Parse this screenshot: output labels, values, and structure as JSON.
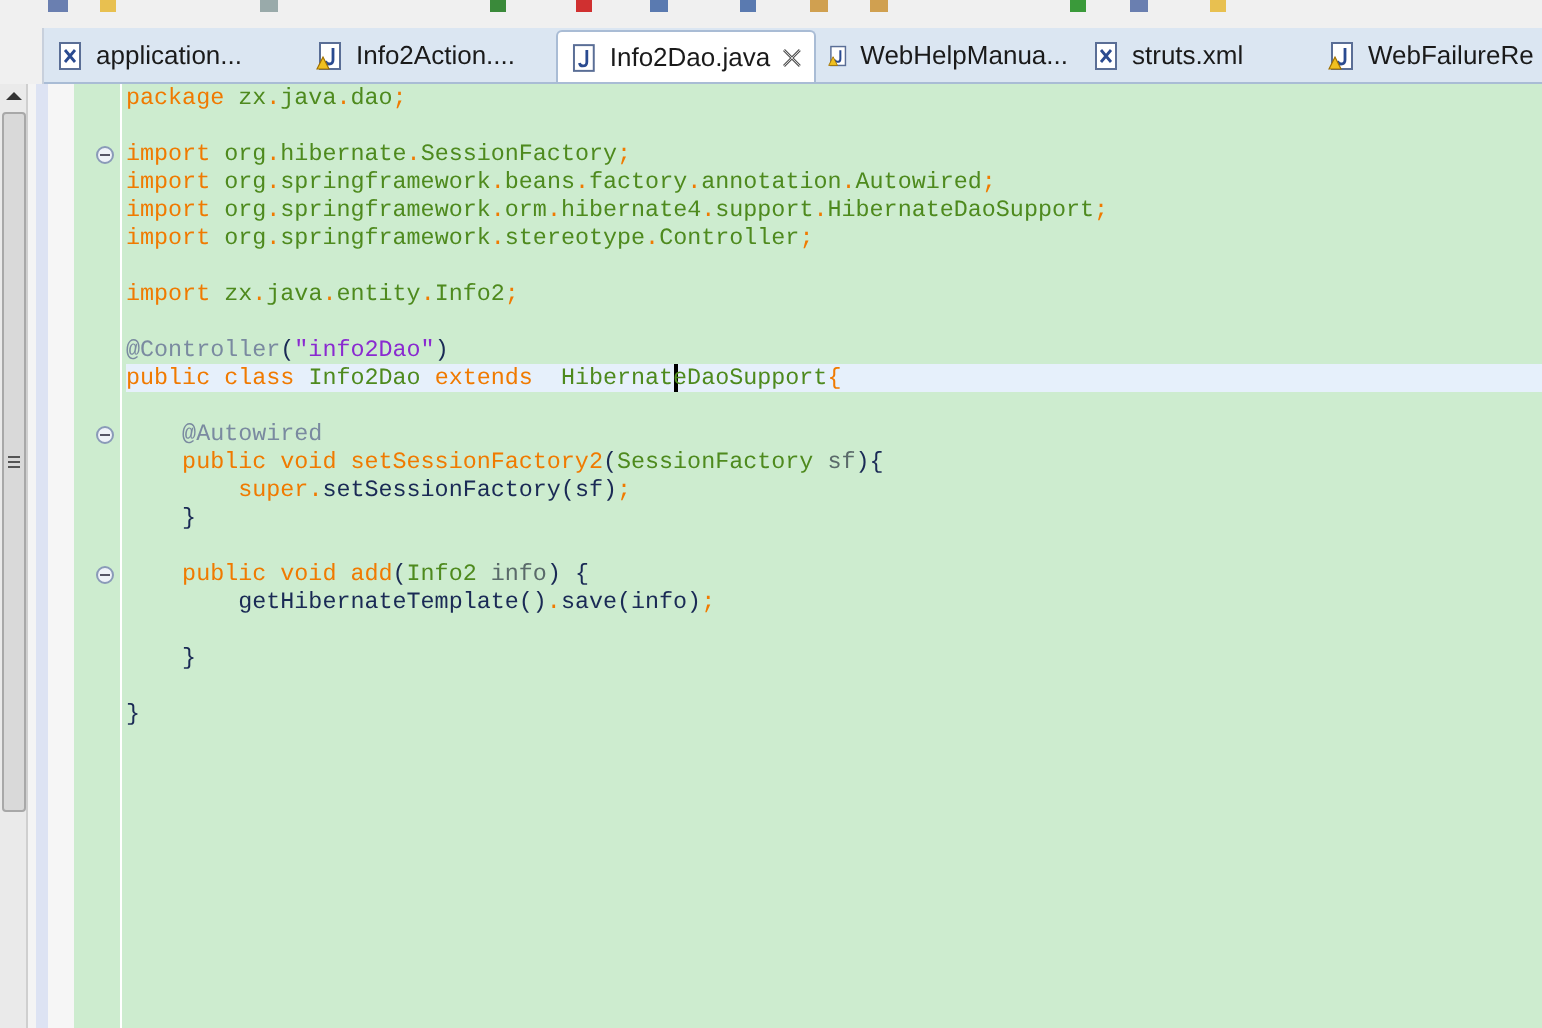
{
  "tabs": [
    {
      "label": "application...",
      "kind": "xml",
      "warning": false,
      "selected": false
    },
    {
      "label": "Info2Action....",
      "kind": "java",
      "warning": true,
      "selected": false
    },
    {
      "label": "Info2Dao.java",
      "kind": "java",
      "warning": false,
      "selected": true
    },
    {
      "label": "WebHelpManua...",
      "kind": "java",
      "warning": true,
      "selected": false
    },
    {
      "label": "struts.xml",
      "kind": "xml",
      "warning": false,
      "selected": false
    },
    {
      "label": "WebFailureRe",
      "kind": "java",
      "warning": true,
      "selected": false
    }
  ],
  "editor": {
    "lines": [
      {
        "fold": false,
        "current": false,
        "tokens": [
          {
            "kind": "keyword",
            "text": "package "
          },
          {
            "kind": "name",
            "text": "zx"
          },
          {
            "kind": "punct",
            "text": "."
          },
          {
            "kind": "name",
            "text": "java"
          },
          {
            "kind": "punct",
            "text": "."
          },
          {
            "kind": "name",
            "text": "dao"
          },
          {
            "kind": "punct",
            "text": ";"
          }
        ]
      },
      {
        "fold": false,
        "current": false
      },
      {
        "fold": true,
        "current": false,
        "tokens": [
          {
            "kind": "keyword",
            "text": "import "
          },
          {
            "kind": "name",
            "text": "org"
          },
          {
            "kind": "punct",
            "text": "."
          },
          {
            "kind": "name",
            "text": "hibernate"
          },
          {
            "kind": "punct",
            "text": "."
          },
          {
            "kind": "name",
            "text": "SessionFactory"
          },
          {
            "kind": "punct",
            "text": ";"
          }
        ]
      },
      {
        "fold": false,
        "current": false,
        "tokens": [
          {
            "kind": "keyword",
            "text": "import "
          },
          {
            "kind": "name",
            "text": "org"
          },
          {
            "kind": "punct",
            "text": "."
          },
          {
            "kind": "name",
            "text": "springframework"
          },
          {
            "kind": "punct",
            "text": "."
          },
          {
            "kind": "name",
            "text": "beans"
          },
          {
            "kind": "punct",
            "text": "."
          },
          {
            "kind": "name",
            "text": "factory"
          },
          {
            "kind": "punct",
            "text": "."
          },
          {
            "kind": "name",
            "text": "annotation"
          },
          {
            "kind": "punct",
            "text": "."
          },
          {
            "kind": "name",
            "text": "Autowired"
          },
          {
            "kind": "punct",
            "text": ";"
          }
        ]
      },
      {
        "fold": false,
        "current": false,
        "tokens": [
          {
            "kind": "keyword",
            "text": "import "
          },
          {
            "kind": "name",
            "text": "org"
          },
          {
            "kind": "punct",
            "text": "."
          },
          {
            "kind": "name",
            "text": "springframework"
          },
          {
            "kind": "punct",
            "text": "."
          },
          {
            "kind": "name",
            "text": "orm"
          },
          {
            "kind": "punct",
            "text": "."
          },
          {
            "kind": "name",
            "text": "hibernate4"
          },
          {
            "kind": "punct",
            "text": "."
          },
          {
            "kind": "name",
            "text": "support"
          },
          {
            "kind": "punct",
            "text": "."
          },
          {
            "kind": "name",
            "text": "HibernateDaoSupport"
          },
          {
            "kind": "punct",
            "text": ";"
          }
        ]
      },
      {
        "fold": false,
        "current": false,
        "tokens": [
          {
            "kind": "keyword",
            "text": "import "
          },
          {
            "kind": "name",
            "text": "org"
          },
          {
            "kind": "punct",
            "text": "."
          },
          {
            "kind": "name",
            "text": "springframework"
          },
          {
            "kind": "punct",
            "text": "."
          },
          {
            "kind": "name",
            "text": "stereotype"
          },
          {
            "kind": "punct",
            "text": "."
          },
          {
            "kind": "name",
            "text": "Controller"
          },
          {
            "kind": "punct",
            "text": ";"
          }
        ]
      },
      {
        "fold": false,
        "current": false
      },
      {
        "fold": false,
        "current": false,
        "tokens": [
          {
            "kind": "keyword",
            "text": "import "
          },
          {
            "kind": "name",
            "text": "zx"
          },
          {
            "kind": "punct",
            "text": "."
          },
          {
            "kind": "name",
            "text": "java"
          },
          {
            "kind": "punct",
            "text": "."
          },
          {
            "kind": "name",
            "text": "entity"
          },
          {
            "kind": "punct",
            "text": "."
          },
          {
            "kind": "name",
            "text": "Info2"
          },
          {
            "kind": "punct",
            "text": ";"
          }
        ]
      },
      {
        "fold": false,
        "current": false
      },
      {
        "fold": false,
        "current": false,
        "tokens": [
          {
            "kind": "annotation",
            "text": "@Controller"
          },
          {
            "kind": "call",
            "text": "("
          },
          {
            "kind": "string",
            "text": "\"info2Dao\""
          },
          {
            "kind": "call",
            "text": ")"
          }
        ]
      },
      {
        "fold": false,
        "current": true,
        "tokens": [
          {
            "kind": "keyword",
            "text": "public class "
          },
          {
            "kind": "name",
            "text": "Info2Dao "
          },
          {
            "kind": "keyword",
            "text": "extends  "
          },
          {
            "kind": "name",
            "text": "Hibernat",
            "caret": true
          },
          {
            "kind": "name",
            "text": "eDaoSupport"
          },
          {
            "kind": "punct",
            "text": "{"
          }
        ]
      },
      {
        "fold": false,
        "current": false
      },
      {
        "fold": true,
        "current": false,
        "tokens": [
          {
            "kind": "annotation",
            "text": "    @Autowired"
          }
        ]
      },
      {
        "fold": false,
        "current": false,
        "tokens": [
          {
            "kind": "keyword",
            "text": "    public void "
          },
          {
            "kind": "method",
            "text": "setSessionFactory2"
          },
          {
            "kind": "call",
            "text": "("
          },
          {
            "kind": "name",
            "text": "SessionFactory "
          },
          {
            "kind": "param",
            "text": "sf"
          },
          {
            "kind": "call",
            "text": "){"
          }
        ]
      },
      {
        "fold": false,
        "current": false,
        "tokens": [
          {
            "kind": "keyword",
            "text": "        super"
          },
          {
            "kind": "punct",
            "text": "."
          },
          {
            "kind": "call",
            "text": "setSessionFactory(sf)"
          },
          {
            "kind": "punct",
            "text": ";"
          }
        ]
      },
      {
        "fold": false,
        "current": false,
        "tokens": [
          {
            "kind": "call",
            "text": "    }"
          }
        ]
      },
      {
        "fold": false,
        "current": false
      },
      {
        "fold": true,
        "current": false,
        "tokens": [
          {
            "kind": "keyword",
            "text": "    public void "
          },
          {
            "kind": "method",
            "text": "add"
          },
          {
            "kind": "call",
            "text": "("
          },
          {
            "kind": "name",
            "text": "Info2 "
          },
          {
            "kind": "param",
            "text": "info"
          },
          {
            "kind": "call",
            "text": ") {"
          }
        ]
      },
      {
        "fold": false,
        "current": false,
        "tokens": [
          {
            "kind": "call",
            "text": "        getHibernateTemplate()"
          },
          {
            "kind": "punct",
            "text": "."
          },
          {
            "kind": "call",
            "text": "save(info)"
          },
          {
            "kind": "punct",
            "text": ";"
          }
        ]
      },
      {
        "fold": false,
        "current": false
      },
      {
        "fold": false,
        "current": false,
        "tokens": [
          {
            "kind": "call",
            "text": "    }"
          }
        ]
      },
      {
        "fold": false,
        "current": false
      },
      {
        "fold": false,
        "current": false,
        "tokens": [
          {
            "kind": "call",
            "text": "}"
          }
        ]
      }
    ]
  }
}
